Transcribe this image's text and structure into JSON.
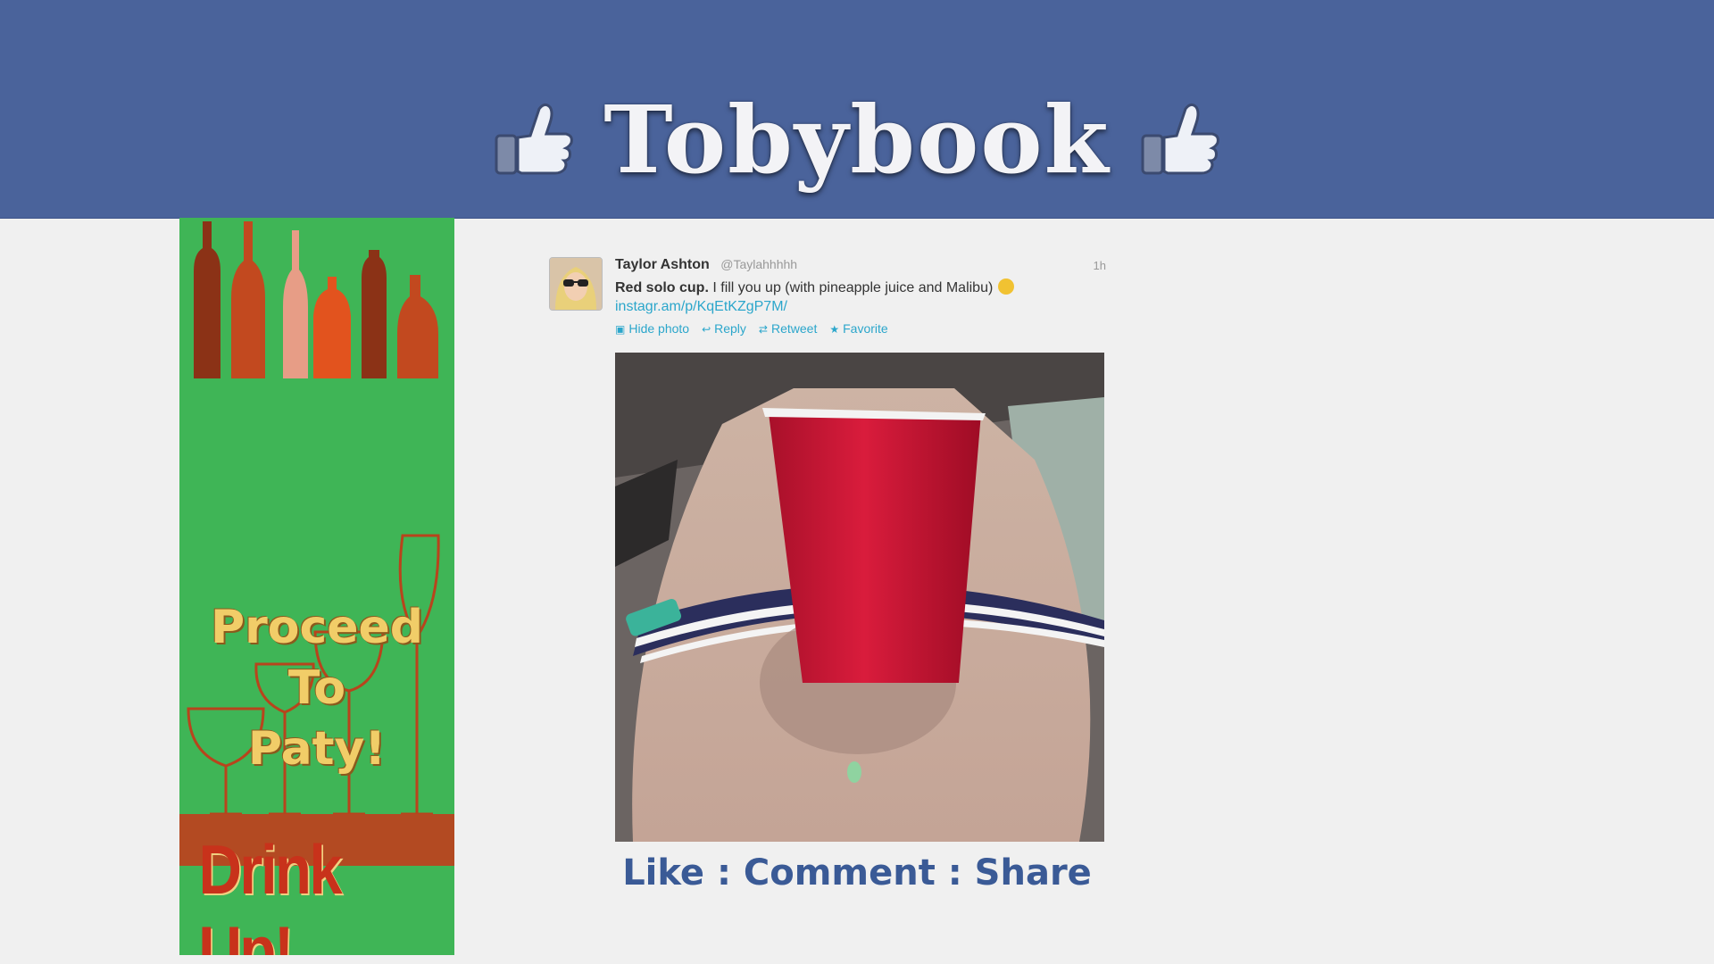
{
  "header": {
    "title": "Tobybook",
    "left_icon": "thumbs-up-icon",
    "right_icon": "thumbs-up-icon",
    "bg_color": "#4a639b"
  },
  "ad": {
    "line1": "Proceed To",
    "line2": "Paty!",
    "tagline": "Drink Up!",
    "colors": {
      "background": "#3fb556",
      "accent_red": "#c8321b",
      "gold": "#f1cd68"
    }
  },
  "tweet": {
    "name": "Taylor Ashton",
    "handle": "@Taylahhhhh",
    "time": "1h",
    "text_bold": "Red solo cup.",
    "text_rest": " I fill you up (with pineapple juice and Malibu)",
    "link": "instagr.am/p/KqEtKZgP7M/",
    "actions": [
      {
        "label": "Hide photo",
        "icon": "photo-icon"
      },
      {
        "label": "Reply",
        "icon": "reply-icon"
      },
      {
        "label": "Retweet",
        "icon": "retweet-icon"
      },
      {
        "label": "Favorite",
        "icon": "star-icon"
      }
    ]
  },
  "footer": {
    "text": "Like : Comment : Share"
  }
}
